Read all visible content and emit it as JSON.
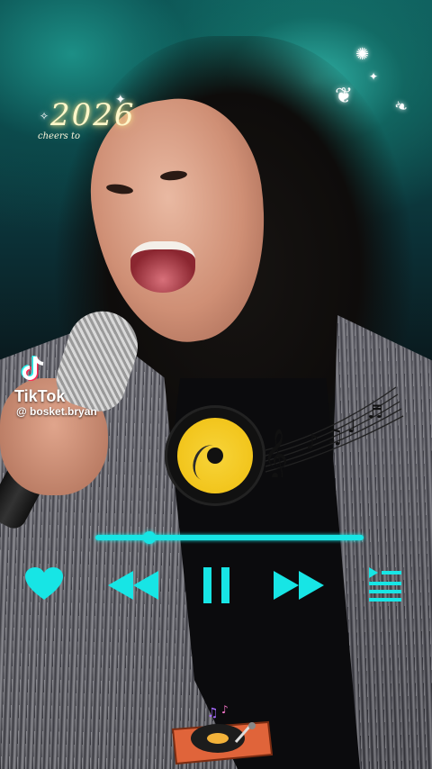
{
  "overlay": {
    "year_text": "2026",
    "greeting_text": "cheers to"
  },
  "branding": {
    "app_name": "TikTok",
    "username": "@ bosket.bryan"
  },
  "player": {
    "progress": 0.2,
    "controls": [
      "heart-icon",
      "rewind-icon",
      "pause-icon",
      "fast-forward-icon",
      "playlist-icon"
    ]
  },
  "colors": {
    "accent": "#17e5e5",
    "disc": "#f2c51c"
  }
}
